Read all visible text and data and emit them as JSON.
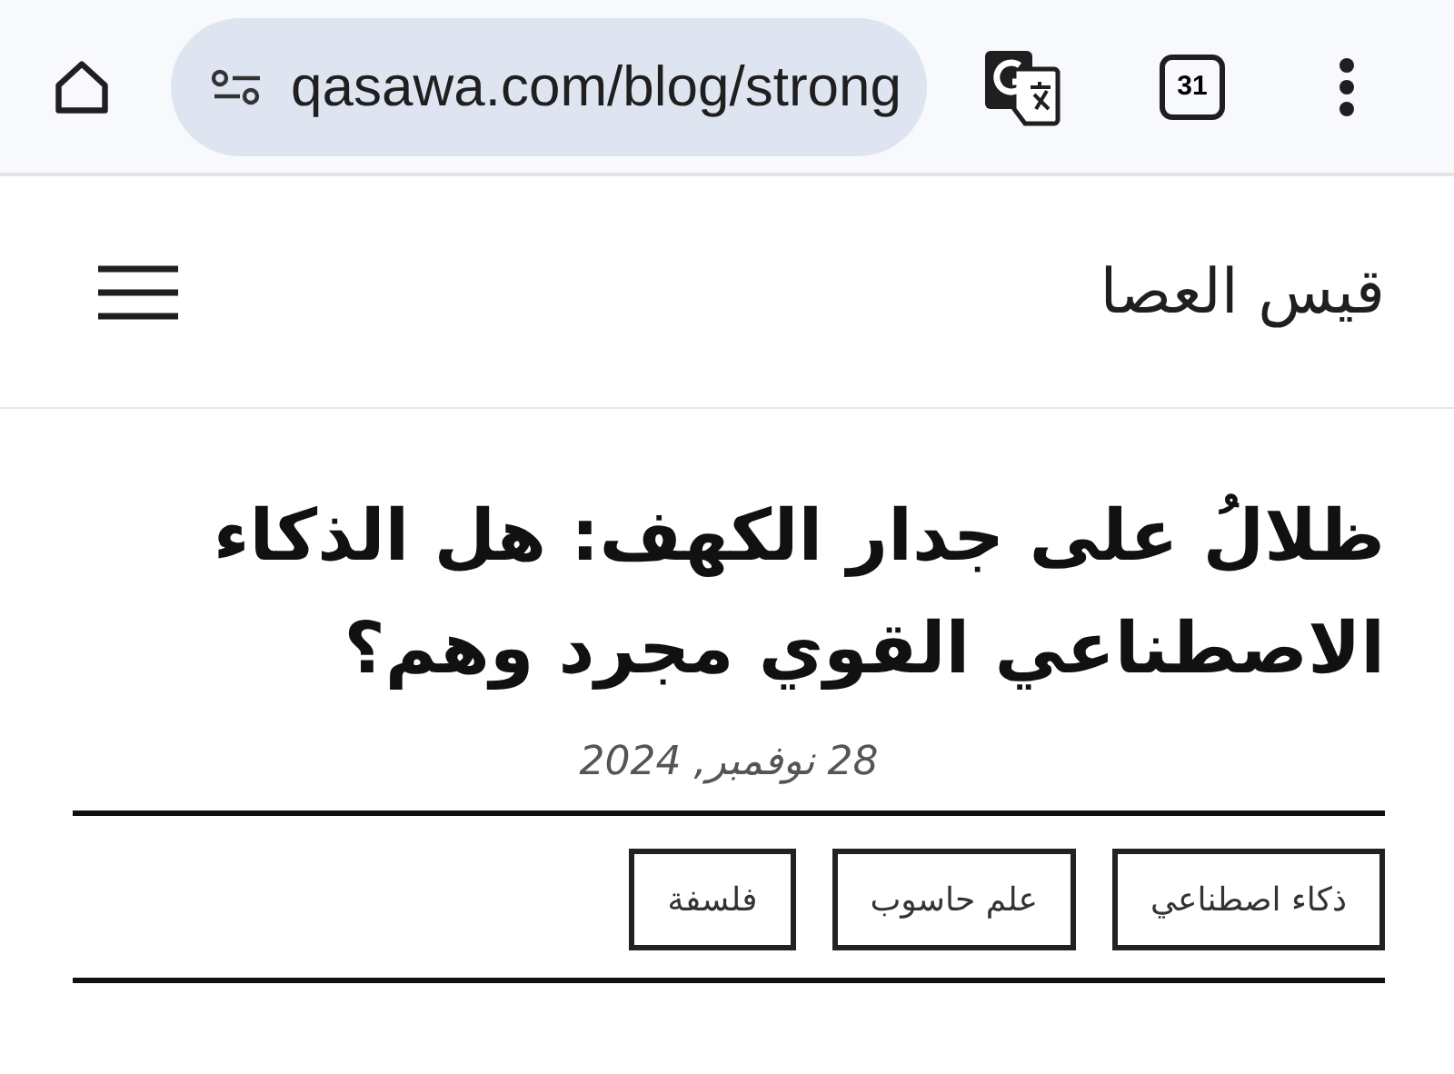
{
  "browser": {
    "url": "qasawa.com/blog/strong",
    "tab_count": "31"
  },
  "site": {
    "title": "قيس العصا"
  },
  "article": {
    "title": "ظلالُ على جدار الكهف: هل الذكاء الاصطناعي القوي مجرد وهم؟",
    "date": "28 نوفمبر, 2024",
    "tags": [
      "ذكاء اصطناعي",
      "علم حاسوب",
      "فلسفة"
    ]
  }
}
